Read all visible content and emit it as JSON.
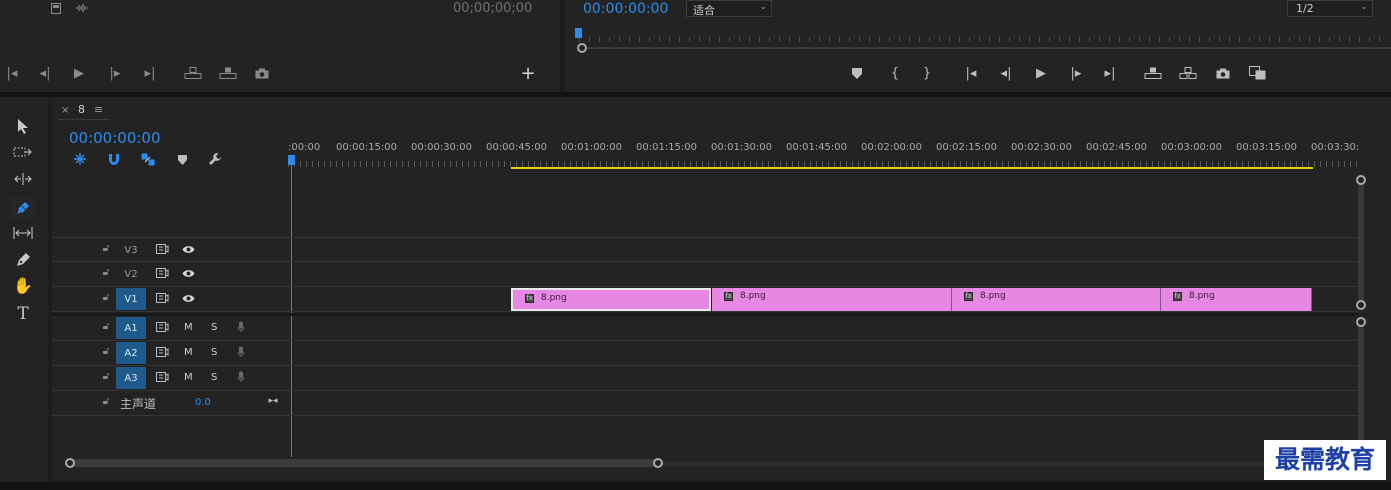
{
  "source_monitor": {
    "timecode": "00;00;00;00"
  },
  "program_monitor": {
    "timecode": "00:00:00:00",
    "zoom_select": "适合",
    "resolution_select": "1/2"
  },
  "timeline": {
    "tab_label": "8",
    "timecode": "00:00:00:00",
    "ruler": [
      ":00:00",
      "00:00:15:00",
      "00:00:30:00",
      "00:00:45:00",
      "00:01:00:00",
      "00:01:15:00",
      "00:01:30:00",
      "00:01:45:00",
      "00:02:00:00",
      "00:02:15:00",
      "00:02:30:00",
      "00:02:45:00",
      "00:03:00:00",
      "00:03:15:00",
      "00:03:30:"
    ],
    "video_tracks": [
      {
        "name": "V3",
        "targeted": false
      },
      {
        "name": "V2",
        "targeted": false
      },
      {
        "name": "V1",
        "targeted": true
      }
    ],
    "audio_tracks": [
      {
        "name": "A1",
        "m": "M",
        "s": "S"
      },
      {
        "name": "A2",
        "m": "M",
        "s": "S"
      },
      {
        "name": "A3",
        "m": "M",
        "s": "S"
      }
    ],
    "master": {
      "label": "主声道",
      "value": "0.0"
    },
    "clips": [
      {
        "name": "8.png",
        "fx": "fx"
      },
      {
        "name": "8.png",
        "fx": "fx"
      },
      {
        "name": "8.png",
        "fx": "fx"
      },
      {
        "name": "8.png",
        "fx": "fx"
      }
    ]
  },
  "colors": {
    "accent_blue": "#2d8ceb",
    "clip_pink": "#e687e3",
    "work_area_yellow": "#e5d500",
    "track_target": "#1e5a8c"
  },
  "watermark": "最需教育"
}
